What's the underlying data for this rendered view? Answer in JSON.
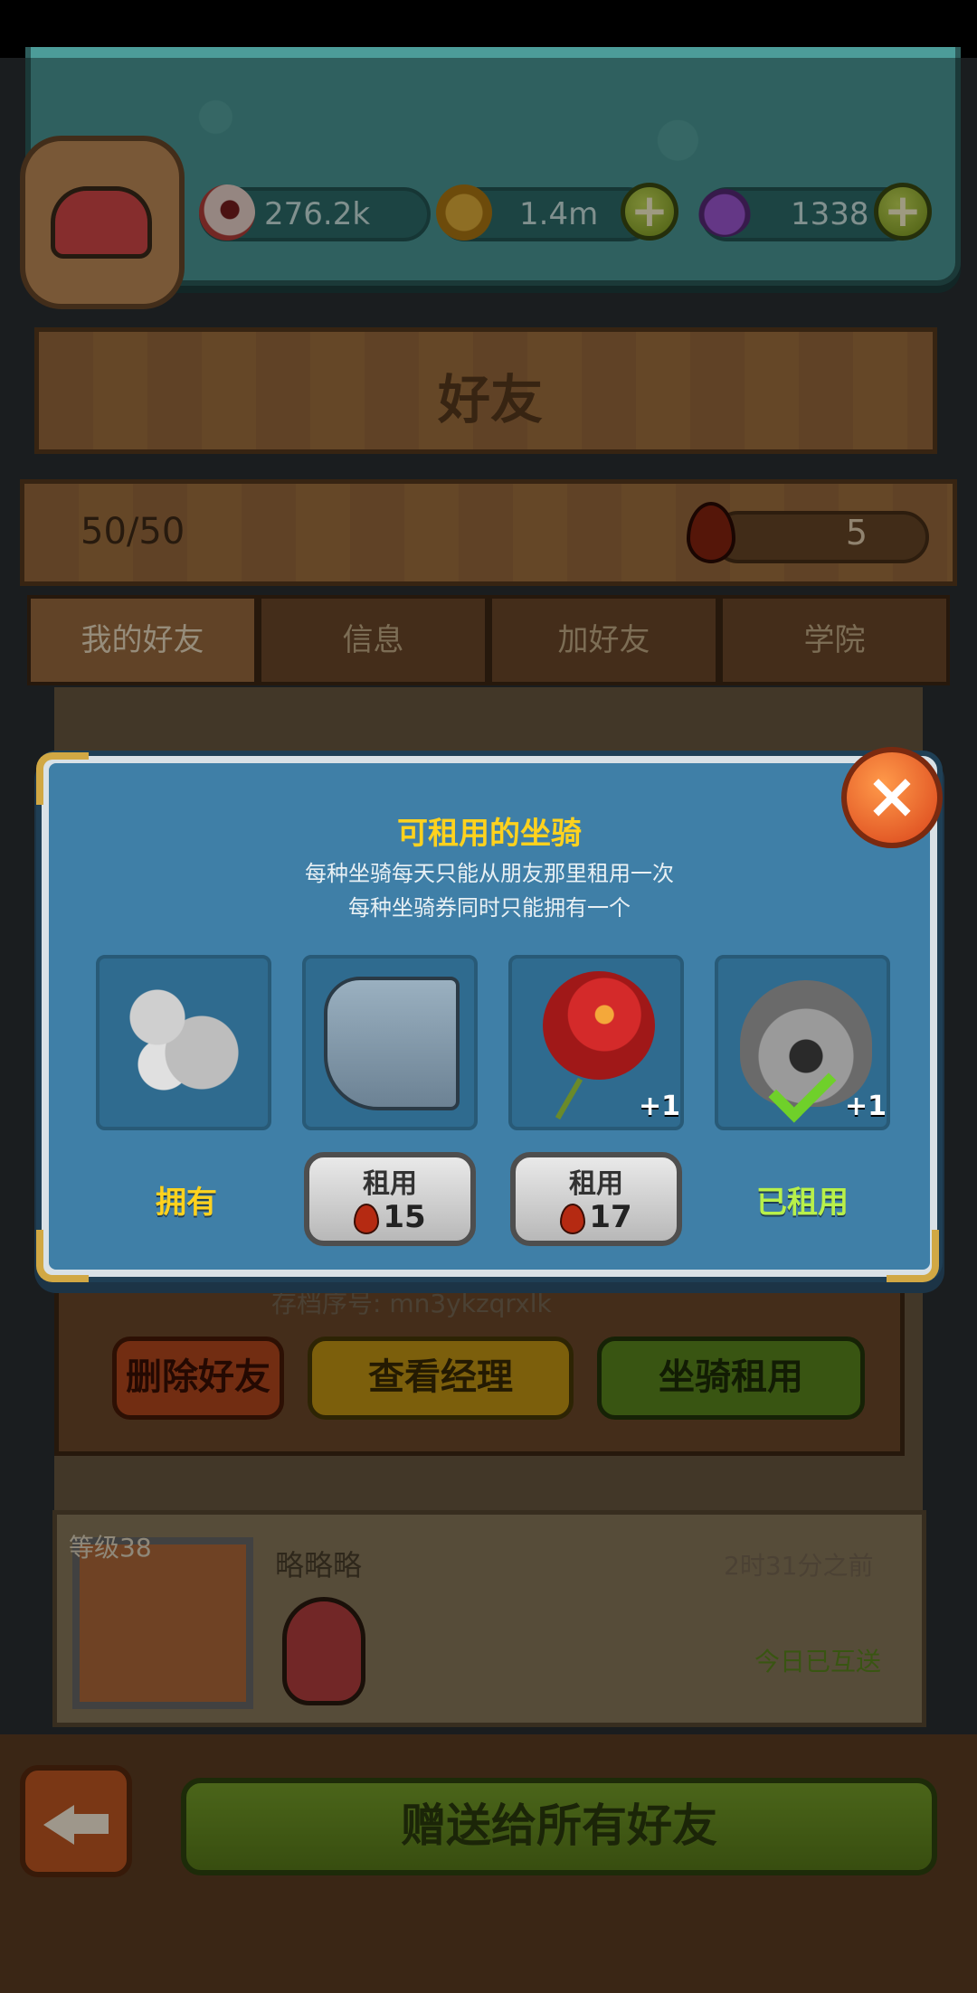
{
  "resources": {
    "eyeballs": "276.2k",
    "coins": "1.4m",
    "potions": "1338",
    "plus": "+"
  },
  "title": "好友",
  "friend_count": "50/50",
  "blood_drops": "5",
  "tabs": [
    "我的好友",
    "信息",
    "加好友",
    "学院"
  ],
  "modal": {
    "title": "可租用的坐骑",
    "subtitle_line1": "每种坐骑每天只能从朋友那里租用一次",
    "subtitle_line2": "每种坐骑券同时只能拥有一个",
    "close": "×",
    "mounts": [
      {
        "icon": "balloon-sheep-mount-icon",
        "status": "拥有",
        "plus": ""
      },
      {
        "icon": "mechanical-crane-mount-icon",
        "rent_label": "租用",
        "cost": "15",
        "plus": ""
      },
      {
        "icon": "rose-mount-icon",
        "rent_label": "租用",
        "cost": "17",
        "plus": "+1"
      },
      {
        "icon": "horned-demon-mount-icon",
        "status": "已租用",
        "plus": "+1"
      }
    ]
  },
  "friend_actions": {
    "save_id": "存档序号: mn3ykzqrxlk",
    "delete": "删除好友",
    "view_manager": "查看经理",
    "rent_mount": "坐骑租用"
  },
  "friend": {
    "level": "等级38",
    "name": "略略略",
    "time": "2时31分之前",
    "status": "今日已互送"
  },
  "bottom": {
    "gift_all": "赠送给所有好友"
  },
  "colors": {
    "teal_panel": "#4c9c99",
    "modal_blue": "#3f7fa7",
    "title_yellow": "#ffd21e",
    "rented_green": "#b8f04a",
    "wood": "#9b6b3e"
  }
}
